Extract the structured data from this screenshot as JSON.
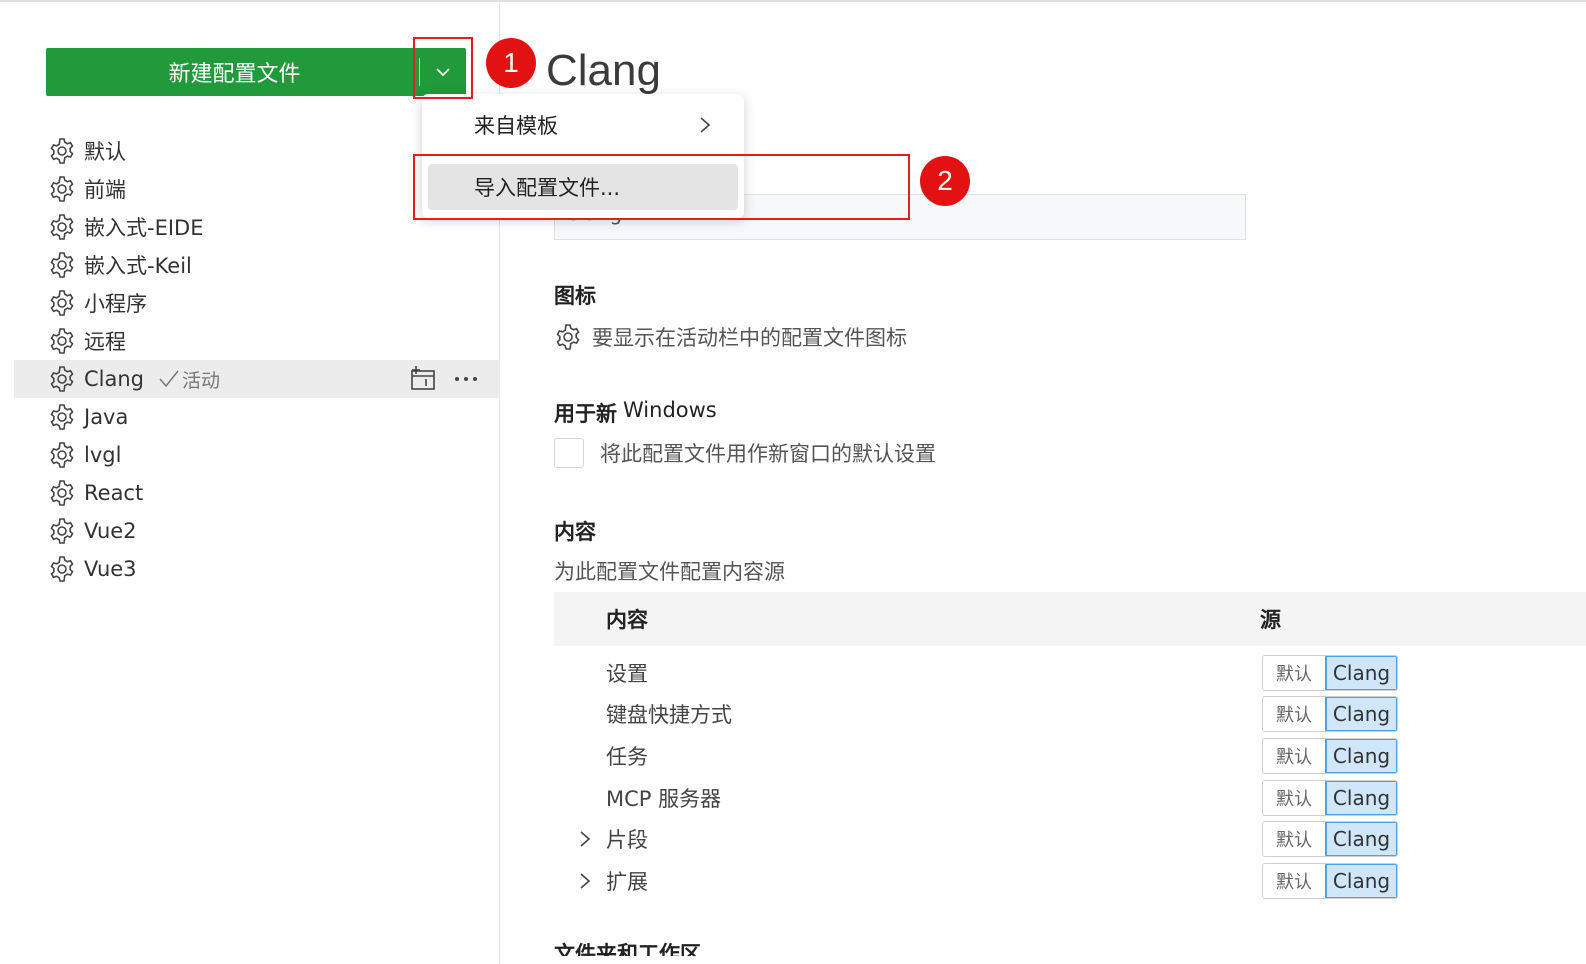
{
  "sidebar": {
    "new_button_label": "新建配置文件",
    "items": [
      {
        "label": "默认"
      },
      {
        "label": "前端"
      },
      {
        "label": "嵌入式-EIDE"
      },
      {
        "label": "嵌入式-Keil"
      },
      {
        "label": "小程序"
      },
      {
        "label": "远程"
      },
      {
        "label": "Clang",
        "active_label": "活动"
      },
      {
        "label": "Java"
      },
      {
        "label": "lvgl"
      },
      {
        "label": "React"
      },
      {
        "label": "Vue2"
      },
      {
        "label": "Vue3"
      }
    ]
  },
  "main": {
    "title": "Clang",
    "name_value": "Clang",
    "icon_heading": "图标",
    "icon_desc": "要显示在活动栏中的配置文件图标",
    "windows_heading_a": "用于新",
    "windows_heading_b": "Windows",
    "windows_checkbox_label": "将此配置文件用作新窗口的默认设置",
    "content_heading": "内容",
    "content_desc": "为此配置文件配置内容源",
    "table": {
      "col_content": "内容",
      "col_source": "源",
      "rows": [
        {
          "label": "设置",
          "src_a": "默认",
          "src_b": "Clang"
        },
        {
          "label": "键盘快捷方式",
          "src_a": "默认",
          "src_b": "Clang"
        },
        {
          "label": "任务",
          "src_a": "默认",
          "src_b": "Clang"
        },
        {
          "label": "MCP 服务器",
          "src_a": "默认",
          "src_b": "Clang"
        },
        {
          "label": "片段",
          "src_a": "默认",
          "src_b": "Clang"
        },
        {
          "label": "扩展",
          "src_a": "默认",
          "src_b": "Clang"
        }
      ]
    },
    "next_heading": "文件夹和工作区"
  },
  "menu": {
    "from_template": "来自模板",
    "import_profile": "导入配置文件..."
  },
  "annotations": {
    "badge_1": "1",
    "badge_2": "2",
    "color": "#e02020"
  },
  "colors": {
    "primary_button": "#209a3a",
    "active_source": "#cfe6fb"
  }
}
